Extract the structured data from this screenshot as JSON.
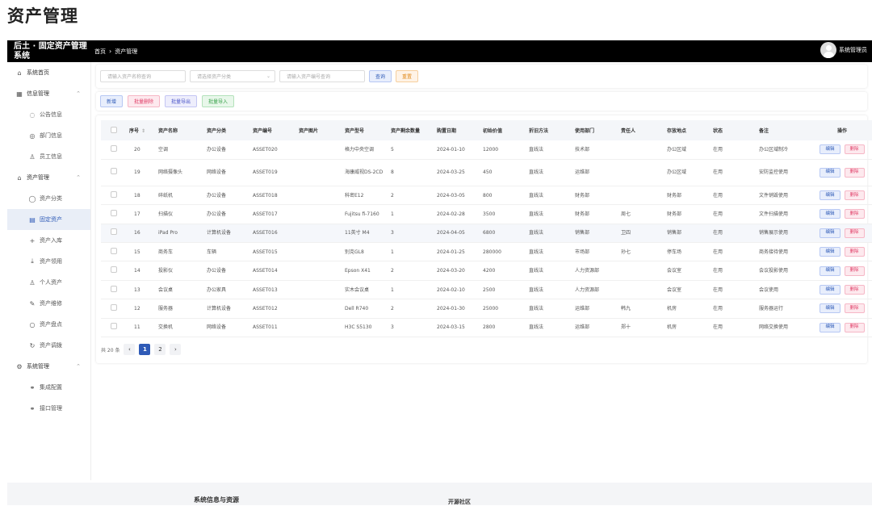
{
  "page": {
    "title": "资产管理"
  },
  "topbar": {
    "brand": "后土 · 固定资产管理系统",
    "crumb_home": "首页",
    "crumb_sep": "›",
    "crumb_current": "资产管理",
    "user_name": "系统管理员"
  },
  "sidebar": {
    "items": [
      {
        "label": "系统首页",
        "icon": "home-icon",
        "glyph": "⌂",
        "level": "top"
      },
      {
        "label": "信息管理",
        "icon": "grid-icon",
        "glyph": "▦",
        "level": "top",
        "expanded": true
      },
      {
        "label": "公告信息",
        "icon": "chat-icon",
        "glyph": "◌",
        "level": "sub"
      },
      {
        "label": "部门信息",
        "icon": "eye-icon",
        "glyph": "◎",
        "level": "sub"
      },
      {
        "label": "员工信息",
        "icon": "user-icon",
        "glyph": "♙",
        "level": "sub"
      },
      {
        "label": "资产管理",
        "icon": "building-icon",
        "glyph": "⌂",
        "level": "top",
        "expanded": true
      },
      {
        "label": "资产分类",
        "icon": "circle-icon",
        "glyph": "◯",
        "level": "sub"
      },
      {
        "label": "固定资产",
        "icon": "document-icon",
        "glyph": "▤",
        "level": "sub",
        "active": true
      },
      {
        "label": "资产入库",
        "icon": "plus-icon",
        "glyph": "+",
        "level": "sub"
      },
      {
        "label": "资产领用",
        "icon": "download-icon",
        "glyph": "⤓",
        "level": "sub"
      },
      {
        "label": "个人资产",
        "icon": "person-icon",
        "glyph": "♙",
        "level": "sub"
      },
      {
        "label": "资产维修",
        "icon": "wrench-icon",
        "glyph": "✎",
        "level": "sub"
      },
      {
        "label": "资产盘点",
        "icon": "search-icon",
        "glyph": "○",
        "level": "sub"
      },
      {
        "label": "资产调拨",
        "icon": "refresh-icon",
        "glyph": "↻",
        "level": "sub"
      },
      {
        "label": "系统管理",
        "icon": "gear-icon",
        "glyph": "⚙",
        "level": "top",
        "expanded": true
      },
      {
        "label": "集成配置",
        "icon": "link-icon",
        "glyph": "⚭",
        "level": "sub"
      },
      {
        "label": "接口管理",
        "icon": "chain-icon",
        "glyph": "⚭",
        "level": "sub"
      }
    ]
  },
  "search": {
    "name_placeholder": "请输入资产名称查询",
    "category_placeholder": "请选择资产分类",
    "code_placeholder": "请输入资产编号查询",
    "query_label": "查询",
    "reset_label": "重置"
  },
  "actions": {
    "add": "新增",
    "batch_delete": "批量删除",
    "batch_export": "批量导出",
    "batch_import": "批量导入"
  },
  "table": {
    "headers": [
      "",
      "序号",
      "资产名称",
      "资产分类",
      "资产编号",
      "资产图片",
      "资产型号",
      "资产剩余数量",
      "购置日期",
      "初始价值",
      "折旧方法",
      "使用部门",
      "责任人",
      "存放地点",
      "状态",
      "备注",
      "操作"
    ],
    "edit_label": "编辑",
    "delete_label": "删除",
    "rows": [
      [
        "20",
        "空调",
        "办公设备",
        "ASSET020",
        "",
        "格力中央空调",
        "5",
        "2024-01-10",
        "12000",
        "直线法",
        "技术部",
        "",
        "办公区域",
        "在用",
        "办公区域制冷"
      ],
      [
        "19",
        "网络摄像头",
        "网络设备",
        "ASSET019",
        "",
        "海康威视DS-2CD",
        "8",
        "2024-03-25",
        "450",
        "直线法",
        "运维部",
        "",
        "办公区域",
        "在用",
        "安防监控使用"
      ],
      [
        "18",
        "碎纸机",
        "办公设备",
        "ASSET018",
        "",
        "科密E12",
        "2",
        "2024-03-05",
        "800",
        "直线法",
        "财务部",
        "",
        "财务部",
        "在用",
        "文件销毁使用"
      ],
      [
        "17",
        "扫描仪",
        "办公设备",
        "ASSET017",
        "",
        "Fujitsu fi-7160",
        "1",
        "2024-02-28",
        "3500",
        "直线法",
        "财务部",
        "周七",
        "财务部",
        "在用",
        "文件扫描使用"
      ],
      [
        "16",
        "iPad Pro",
        "计算机设备",
        "ASSET016",
        "",
        "11英寸 M4",
        "3",
        "2024-04-05",
        "6800",
        "直线法",
        "销售部",
        "卫四",
        "销售部",
        "在用",
        "销售展示使用"
      ],
      [
        "15",
        "商务车",
        "车辆",
        "ASSET015",
        "",
        "别克GL8",
        "1",
        "2024-01-25",
        "280000",
        "直线法",
        "市场部",
        "孙七",
        "停车场",
        "在用",
        "商务接待使用"
      ],
      [
        "14",
        "投影仪",
        "办公设备",
        "ASSET014",
        "",
        "Epson X41",
        "2",
        "2024-03-20",
        "4200",
        "直线法",
        "人力资源部",
        "",
        "会议室",
        "在用",
        "会议投影使用"
      ],
      [
        "13",
        "会议桌",
        "办公家具",
        "ASSET013",
        "",
        "实木会议桌",
        "1",
        "2024-02-10",
        "2500",
        "直线法",
        "人力资源部",
        "",
        "会议室",
        "在用",
        "会议使用"
      ],
      [
        "12",
        "服务器",
        "计算机设备",
        "ASSET012",
        "",
        "Dell R740",
        "2",
        "2024-01-30",
        "25000",
        "直线法",
        "运维部",
        "韩九",
        "机房",
        "在用",
        "服务器运行"
      ],
      [
        "11",
        "交换机",
        "网络设备",
        "ASSET011",
        "",
        "H3C S5130",
        "3",
        "2024-03-15",
        "2800",
        "直线法",
        "运维部",
        "郑十",
        "机房",
        "在用",
        "网络交换使用"
      ]
    ]
  },
  "pager": {
    "total": "共 20 条",
    "prev": "‹",
    "pages": [
      "1",
      "2"
    ],
    "next": "›",
    "current": "1"
  },
  "footer": {
    "col1": "系统信息与资源",
    "col2": "开源社区"
  }
}
